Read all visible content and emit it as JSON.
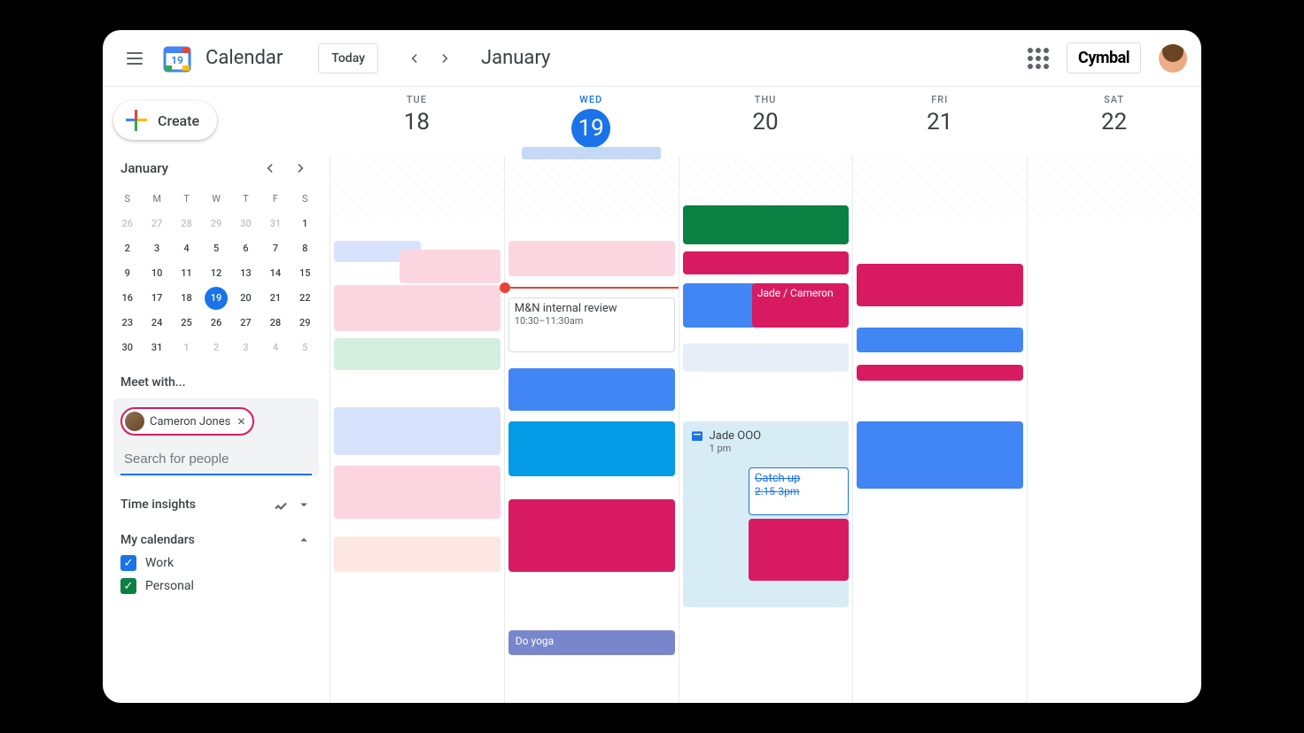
{
  "header": {
    "app_title": "Calendar",
    "today_label": "Today",
    "month_title": "January",
    "brand": "Cymbal",
    "logo_day": "19"
  },
  "create": {
    "label": "Create"
  },
  "mini_cal": {
    "month": "January",
    "dow": [
      "S",
      "M",
      "T",
      "W",
      "T",
      "F",
      "S"
    ],
    "weeks": [
      [
        {
          "d": "26",
          "o": 1
        },
        {
          "d": "27",
          "o": 1
        },
        {
          "d": "28",
          "o": 1
        },
        {
          "d": "29",
          "o": 1
        },
        {
          "d": "30",
          "o": 1
        },
        {
          "d": "31",
          "o": 1
        },
        {
          "d": "1",
          "o": 0
        }
      ],
      [
        {
          "d": "2",
          "o": 0
        },
        {
          "d": "3",
          "o": 0
        },
        {
          "d": "4",
          "o": 0
        },
        {
          "d": "5",
          "o": 0
        },
        {
          "d": "6",
          "o": 0
        },
        {
          "d": "7",
          "o": 0
        },
        {
          "d": "8",
          "o": 0
        }
      ],
      [
        {
          "d": "9",
          "o": 0
        },
        {
          "d": "10",
          "o": 0
        },
        {
          "d": "11",
          "o": 0
        },
        {
          "d": "12",
          "o": 0
        },
        {
          "d": "13",
          "o": 0
        },
        {
          "d": "14",
          "o": 0
        },
        {
          "d": "15",
          "o": 0
        }
      ],
      [
        {
          "d": "16",
          "o": 0
        },
        {
          "d": "17",
          "o": 0
        },
        {
          "d": "18",
          "o": 0
        },
        {
          "d": "19",
          "o": 0,
          "t": 1
        },
        {
          "d": "20",
          "o": 0
        },
        {
          "d": "21",
          "o": 0
        },
        {
          "d": "22",
          "o": 0
        }
      ],
      [
        {
          "d": "23",
          "o": 0
        },
        {
          "d": "24",
          "o": 0
        },
        {
          "d": "25",
          "o": 0
        },
        {
          "d": "26",
          "o": 0
        },
        {
          "d": "27",
          "o": 0
        },
        {
          "d": "28",
          "o": 0
        },
        {
          "d": "29",
          "o": 0
        }
      ],
      [
        {
          "d": "30",
          "o": 0
        },
        {
          "d": "31",
          "o": 0
        },
        {
          "d": "1",
          "o": 1
        },
        {
          "d": "2",
          "o": 1
        },
        {
          "d": "3",
          "o": 1
        },
        {
          "d": "4",
          "o": 1
        },
        {
          "d": "5",
          "o": 1
        }
      ]
    ]
  },
  "meet": {
    "label": "Meet with...",
    "chip_name": "Cameron Jones",
    "placeholder": "Search for people"
  },
  "time_insights": {
    "label": "Time insights"
  },
  "my_calendars": {
    "label": "My calendars",
    "items": [
      {
        "name": "Work",
        "color": "blue"
      },
      {
        "name": "Personal",
        "color": "green"
      }
    ]
  },
  "days": [
    {
      "dow": "TUE",
      "date": "18",
      "active": false
    },
    {
      "dow": "WED",
      "date": "19",
      "active": true
    },
    {
      "dow": "THU",
      "date": "20",
      "active": false
    },
    {
      "dow": "FRI",
      "date": "21",
      "active": false
    },
    {
      "dow": "SAT",
      "date": "22",
      "active": false
    }
  ],
  "events": {
    "mn_review": {
      "title": "M&N internal review",
      "time": "10:30–11:30am"
    },
    "jade_cam": {
      "title": "Jade / Cameron"
    },
    "jade_ooo": {
      "title": "Jade OOO",
      "time": "1 pm"
    },
    "catchup": {
      "title": "Catch up",
      "time": "2:15-3pm"
    },
    "yoga": {
      "title": "Do yoga"
    }
  }
}
